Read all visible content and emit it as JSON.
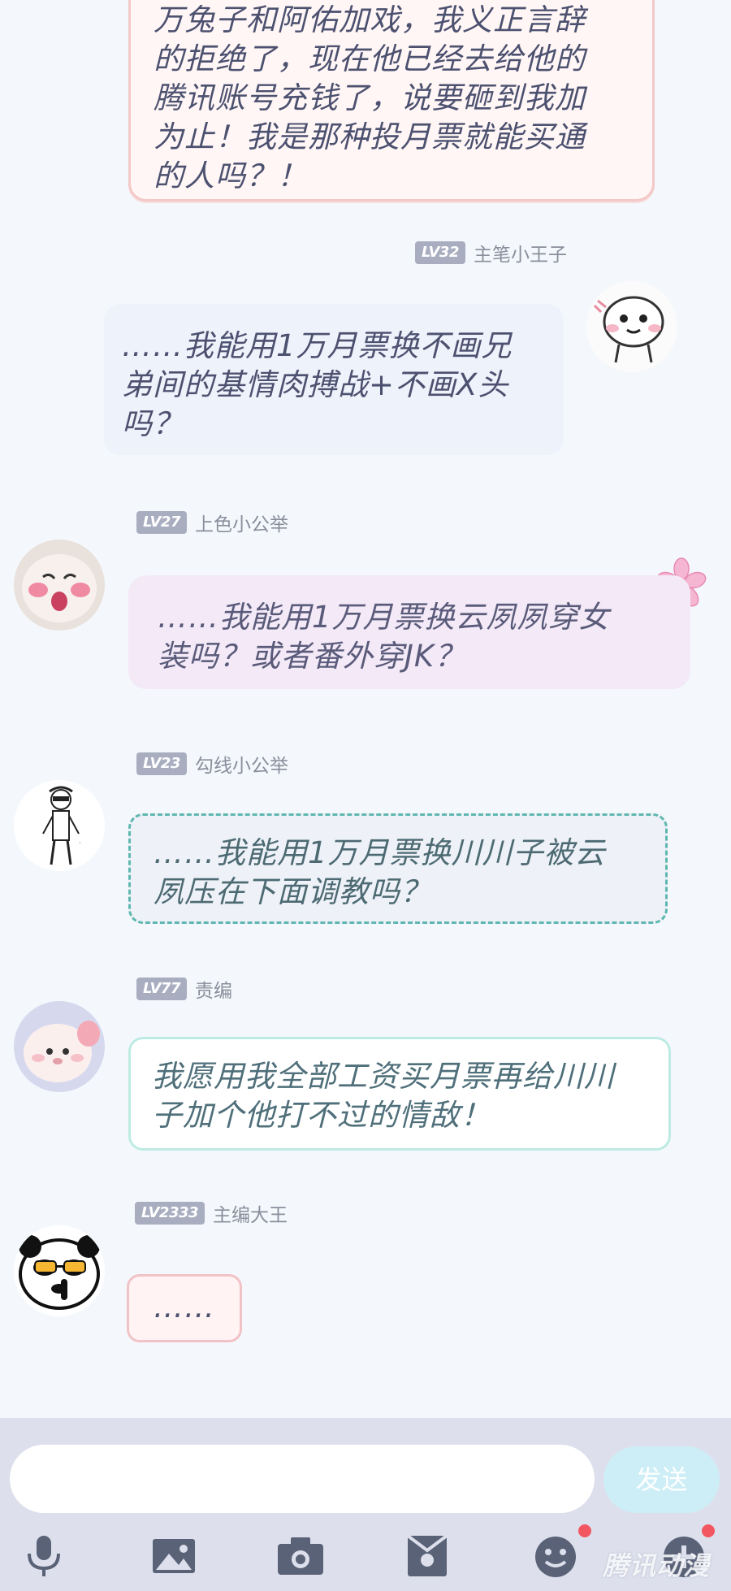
{
  "messages": [
    {
      "text": "万兔子和阿佑加戏，我义正言辞\n的拒绝了，现在他已经去给他的\n腾讯账号充钱了，说要砸到我加\n为止！我是那种投月票就能买通\n的人吗？！"
    },
    {
      "level": "LV32",
      "name": "主笔小王子",
      "text": "……我能用1万月票换不画兄\n弟间的基情肉搏战+不画X头\n吗？"
    },
    {
      "level": "LV27",
      "name": "上色小公举",
      "text": "……我能用1万月票换云夙夙穿女\n装吗？或者番外穿JK？"
    },
    {
      "level": "LV23",
      "name": "勾线小公举",
      "text": "……我能用1万月票换川川子被云\n夙压在下面调教吗？"
    },
    {
      "level": "LV77",
      "name": "责编",
      "text": "我愿用我全部工资买月票再给川川\n子加个他打不过的情敌！"
    },
    {
      "level": "LV2333",
      "name": "主编大王",
      "text": "……"
    }
  ],
  "input": {
    "placeholder": "",
    "send_label": "发送"
  },
  "toolbar": {
    "icons": [
      "microphone-icon",
      "image-icon",
      "camera-icon",
      "envelope-icon",
      "emoji-icon",
      "plus-icon"
    ]
  },
  "watermark": "腾讯动漫",
  "colors": {
    "accent": "#cdeef6",
    "badge": "#f25661",
    "level_badge": "#a8adc0"
  }
}
